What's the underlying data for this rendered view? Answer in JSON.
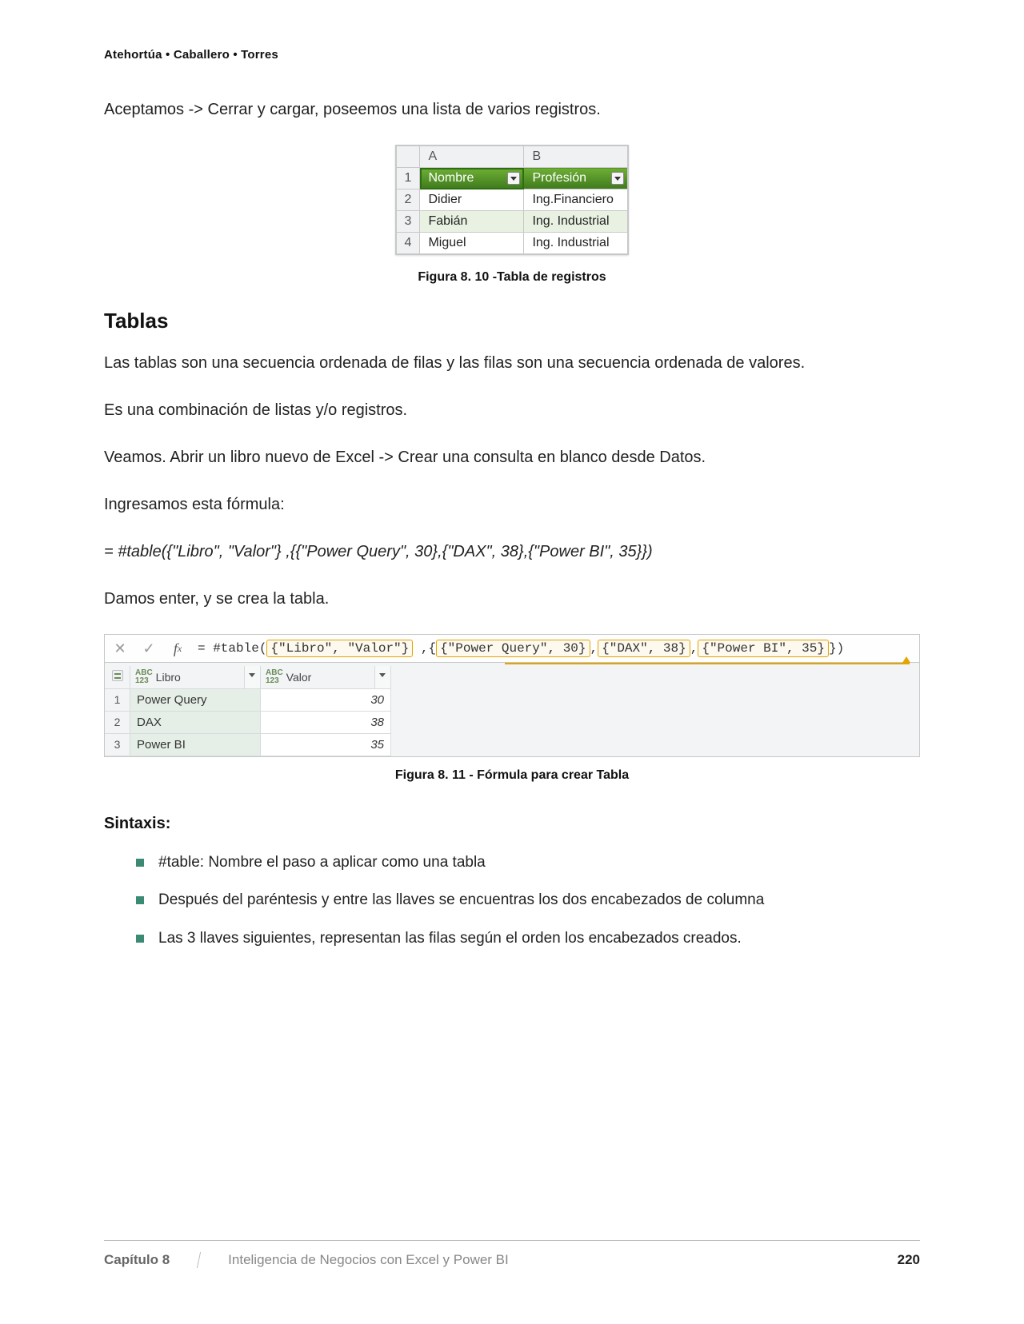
{
  "header": {
    "authors": "Atehortúa • Caballero • Torres"
  },
  "intro": {
    "p1": "Aceptamos -> Cerrar y cargar, poseemos una lista de varios registros."
  },
  "fig10": {
    "caption": "Figura 8. 10 -Tabla de registros",
    "col_a": "A",
    "col_b": "B",
    "hdr_nombre": "Nombre",
    "hdr_profesion": "Profesión",
    "rows": [
      {
        "n": "2",
        "nombre": "Didier",
        "prof": "Ing.Financiero"
      },
      {
        "n": "3",
        "nombre": "Fabián",
        "prof": "Ing. Industrial"
      },
      {
        "n": "4",
        "nombre": "Miguel",
        "prof": "Ing. Industrial"
      }
    ],
    "row1": "1"
  },
  "section_title": "Tablas",
  "paras": {
    "p2": "Las tablas son una secuencia ordenada de filas y las filas son una secuencia ordenada de valores.",
    "p3": "Es una combinación de listas y/o registros.",
    "p4": "Veamos. Abrir un libro nuevo de Excel -> Crear una consulta en blanco desde Datos.",
    "p5": "Ingresamos esta fórmula:",
    "formula": "= #table({\"Libro\",  \"Valor\"} ,{{\"Power Query\", 30},{\"DAX\", 38},{\"Power BI\", 35}})",
    "p6": "Damos enter, y se crea la tabla."
  },
  "fig11": {
    "caption": "Figura 8. 11 - Fórmula para crear Tabla",
    "fx_prefix": "= #table(",
    "hl_cols": "{\"Libro\",  \"Valor\"}",
    "sep1": " ,{",
    "hl_r1": "{\"Power Query\", 30}",
    "sep2": ",",
    "hl_r2": "{\"DAX\", 38}",
    "sep3": ",",
    "hl_r3": "{\"Power BI\", 35}",
    "suffix": "})",
    "col_libro": "Libro",
    "col_valor": "Valor",
    "abc": "ABC",
    "n123": "123",
    "rows": [
      {
        "n": "1",
        "libro": "Power Query",
        "valor": "30"
      },
      {
        "n": "2",
        "libro": "DAX",
        "valor": "38"
      },
      {
        "n": "3",
        "libro": "Power BI",
        "valor": "35"
      }
    ]
  },
  "sintaxis": {
    "title": "Sintaxis:",
    "b1": "#table: Nombre el paso a aplicar como una tabla",
    "b2": "Después del paréntesis y entre las llaves se encuentras los dos encabezados de columna",
    "b3": "Las 3 llaves siguientes, representan las filas según el orden los encabezados creados."
  },
  "footer": {
    "chapter": "Capítulo 8",
    "title": "Inteligencia de Negocios con Excel y Power BI",
    "page": "220"
  }
}
